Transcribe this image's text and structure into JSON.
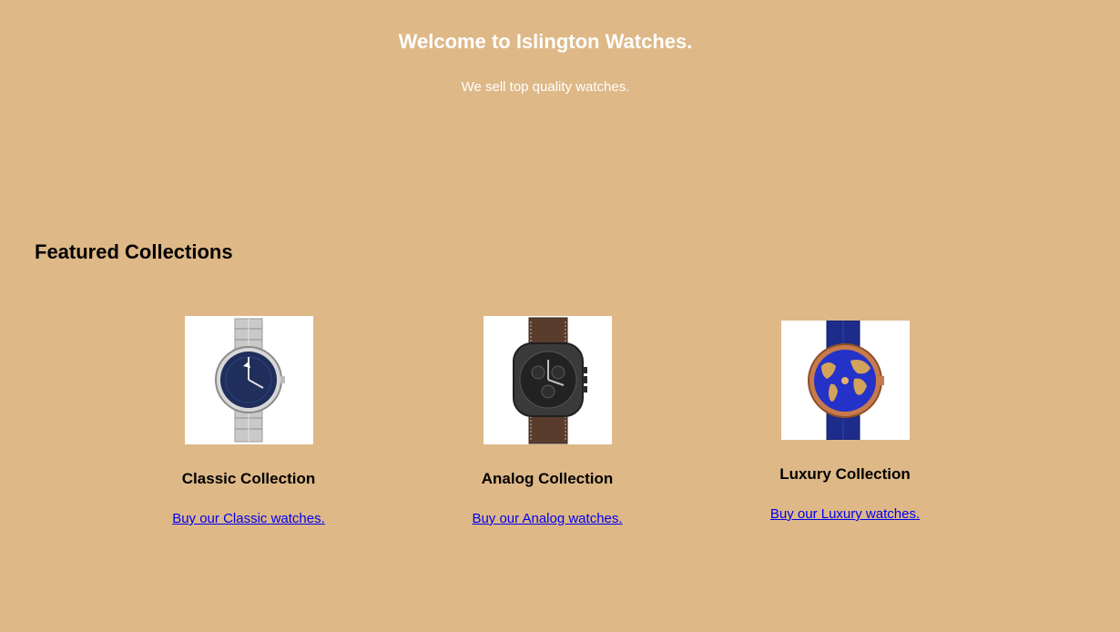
{
  "header": {
    "title": "Welcome to Islington Watches.",
    "subtitle": "We sell top quality watches."
  },
  "featured": {
    "heading": "Featured Collections",
    "collections": [
      {
        "image_icon": "silver-watch-image",
        "title": "Classic Collection",
        "link": "Buy our Classic watches."
      },
      {
        "image_icon": "black-chronograph-watch-image",
        "title": "Analog Collection",
        "link": "Buy our Analog watches."
      },
      {
        "image_icon": "world-map-luxury-watch-image",
        "title": "Luxury Collection",
        "link": "Buy our Luxury watches."
      }
    ]
  },
  "colors": {
    "background": "#deb887",
    "hero_text": "#ffffff",
    "link": "#0000ee"
  }
}
